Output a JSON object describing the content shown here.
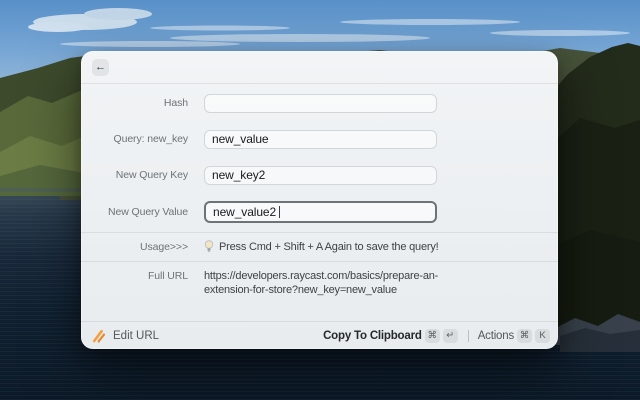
{
  "window": {
    "header": {
      "back_icon": "←"
    },
    "form": {
      "fields": [
        {
          "label": "Hash",
          "value": ""
        },
        {
          "label": "Query: new_key",
          "value": "new_value"
        },
        {
          "label": "New Query Key",
          "value": "new_key2"
        },
        {
          "label": "New Query Value",
          "value": "new_value2"
        }
      ],
      "usage": {
        "label": "Usage>>>",
        "icon": "lightbulb",
        "text": "Press Cmd + Shift + A Again to save the query!"
      },
      "full_url": {
        "label": "Full URL",
        "line1": "https://developers.raycast.com/basics/prepare-an-",
        "line2": "extension-for-store?new_key=new_value"
      }
    },
    "footer": {
      "app_icon": "edit-url-brush",
      "app_label": "Edit URL",
      "primary_action": {
        "label": "Copy To Clipboard",
        "keys": [
          "⌘",
          "↵"
        ]
      },
      "secondary_action": {
        "label": "Actions",
        "keys": [
          "⌘",
          "K"
        ]
      }
    }
  },
  "colors": {
    "accent_orange": "#f59e3d",
    "focus_border": "#6e7377",
    "badge_bg": "#d9dcde",
    "window_bg": "#eef1f3"
  }
}
